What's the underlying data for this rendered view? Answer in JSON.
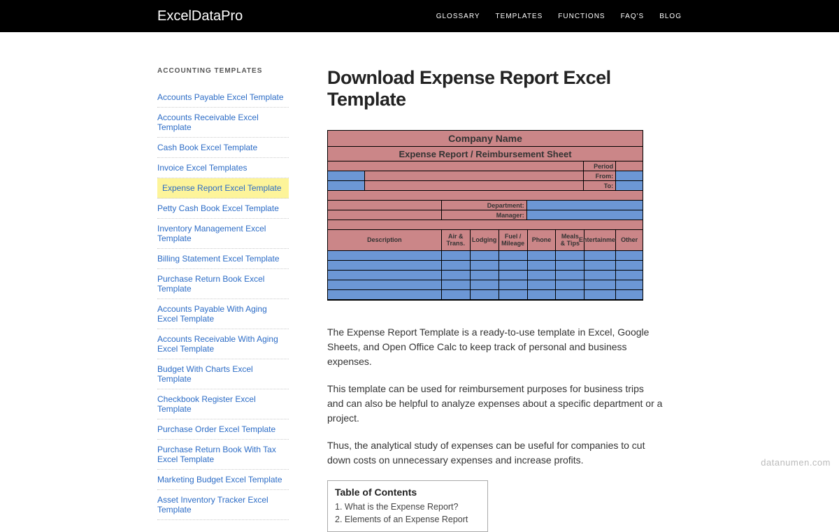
{
  "brand": "ExcelDataPro",
  "nav": [
    "GLOSSARY",
    "TEMPLATES",
    "FUNCTIONS",
    "FAQ'S",
    "BLOG"
  ],
  "sidebar": {
    "heading": "ACCOUNTING TEMPLATES",
    "items": [
      "Accounts Payable Excel Template",
      "Accounts Receivable Excel Template",
      "Cash Book Excel Template",
      "Invoice Excel Templates",
      "Expense Report Excel Template",
      "Petty Cash Book Excel Template",
      "Inventory Management Excel Template",
      "Billing Statement Excel Template",
      "Purchase Return Book Excel Template",
      "Accounts Payable With Aging Excel Template",
      "Accounts Receivable With Aging Excel Template",
      "Budget With Charts Excel Template",
      "Checkbook Register Excel Template",
      "Purchase Order Excel Template",
      "Purchase Return Book With Tax Excel Template",
      "Marketing Budget Excel Template",
      "Asset Inventory Tracker Excel Template"
    ],
    "activeIndex": 4
  },
  "page": {
    "title": "Download Expense Report Excel Template",
    "sheet": {
      "company": "Company Name",
      "subtitle": "Expense Report / Reimbursement Sheet",
      "period": "Period",
      "from": "From:",
      "to": "To:",
      "department": "Department:",
      "manager": "Manager:",
      "headers": [
        "Description",
        "Air & Trans.",
        "Lodging",
        "Fuel / Mileage",
        "Phone",
        "Meals & Tips",
        "Entertainment",
        "Other"
      ]
    },
    "paragraphs": [
      "The Expense Report Template is a ready-to-use template in Excel, Google Sheets, and Open Office Calc to keep track of personal and business expenses.",
      "This template can be used for reimbursement purposes for business trips and can also be helpful to analyze expenses about a specific department or a project.",
      "Thus, the analytical study of expenses can be useful for companies to cut down costs on unnecessary expenses and increase profits."
    ],
    "toc": {
      "title": "Table of Contents",
      "items": [
        "1. What is the Expense Report?",
        "2. Elements of an Expense Report"
      ]
    }
  },
  "watermark": "datanumen.com"
}
